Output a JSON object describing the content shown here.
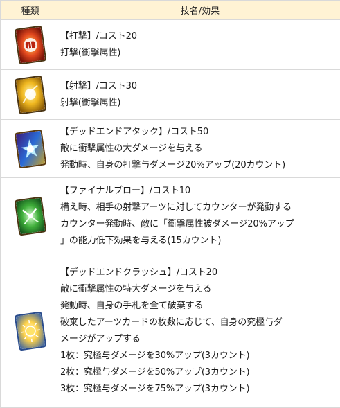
{
  "table": {
    "headers": {
      "type": "種類",
      "skill": "技名/効果"
    },
    "rows": [
      {
        "icon": "red-fist-card-icon",
        "lines": [
          "【打撃】/コスト20",
          "打撃(衝撃属性)"
        ]
      },
      {
        "icon": "gold-ball-card-icon",
        "lines": [
          "【射撃】/コスト30",
          "射撃(衝撃属性)"
        ]
      },
      {
        "icon": "blue-burst-card-icon",
        "lines": [
          "【デッドエンドアタック】/コスト50",
          "敵に衝撃属性の大ダメージを与える",
          "発動時、自身の打撃与ダメージ20%アップ(20カウント)"
        ]
      },
      {
        "icon": "green-counter-card-icon",
        "lines": [
          "【ファイナルブロー】/コスト10",
          "構え時、相手の射撃アーツに対してカウンターが発動する",
          "カウンター発動時、敵に「衝撃属性被ダメージ20%アップ",
          "」の能力低下効果を与える(15カウント)"
        ]
      },
      {
        "icon": "sun-burst-card-icon",
        "lines": [
          "【デッドエンドクラッシュ】/コスト20",
          "敵に衝撃属性の特大ダメージを与える",
          "発動時、自身の手札を全て破棄する",
          "破棄したアーツカードの枚数に応じて、自身の究極与ダ",
          "メージがアップする",
          "1枚：究極与ダメージを30%アップ(3カウント)",
          "2枚：究極与ダメージを50%アップ(3カウント)",
          "3枚：究極与ダメージを75%アップ(3カウント)"
        ]
      }
    ]
  }
}
